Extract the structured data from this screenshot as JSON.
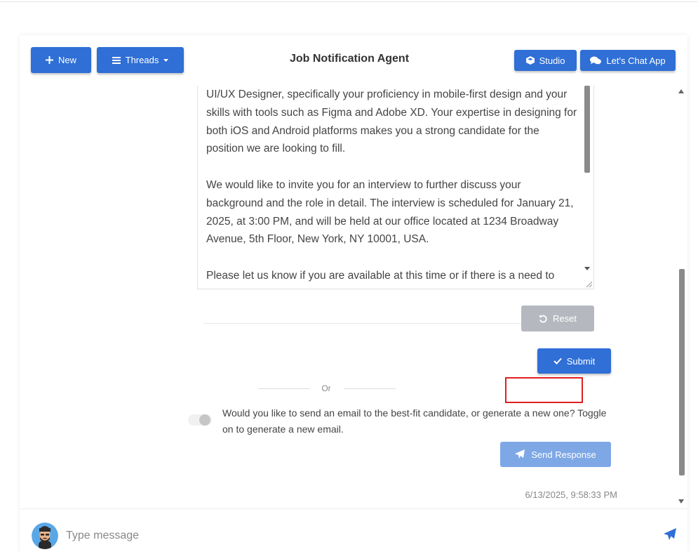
{
  "header": {
    "new_label": "New",
    "threads_label": "Threads",
    "title": "Job Notification Agent",
    "studio_label": "Studio",
    "chat_app_label": "Let's Chat App"
  },
  "letter": {
    "text": "UI/UX Designer, specifically your proficiency in mobile-first design and your skills with tools such as Figma and Adobe XD. Your expertise in designing for both iOS and Android platforms makes you a strong candidate for the position we are looking to fill.\n\nWe would like to invite you for an interview to further discuss your background and the role in detail. The interview is scheduled for January 21, 2025, at 3:00 PM, and will be held at our office located at 1234 Broadway Avenue, 5th Floor, New York, NY 10001, USA.\n\nPlease let us know if you are available at this time or if there is a need to"
  },
  "actions": {
    "reset_label": "Reset",
    "submit_label": "Submit",
    "or_label": "Or",
    "toggle_text": "Would you like to send an email to the best-fit candidate, or generate a new one? Toggle on to generate a new email.",
    "toggle_on": false,
    "send_response_label": "Send Response",
    "timestamp": "6/13/2025, 9:58:33 PM"
  },
  "footer": {
    "placeholder": "Type message"
  },
  "colors": {
    "primary": "#2f6fd6",
    "disabled_gray": "#b5b9bf",
    "send_light": "#7ea7e6",
    "highlight": "#e02020"
  }
}
